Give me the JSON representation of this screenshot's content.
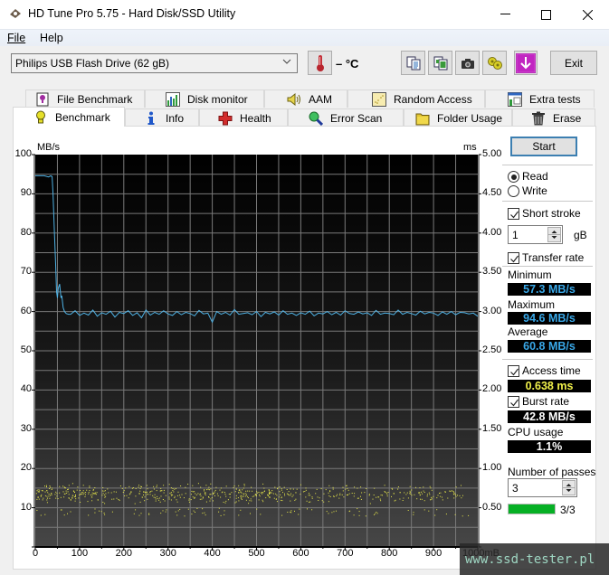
{
  "window": {
    "title": "HD Tune Pro 5.75 - Hard Disk/SSD Utility",
    "minimize_icon": "minimize-icon",
    "maximize_icon": "maximize-icon",
    "close_icon": "close-icon"
  },
  "menu": {
    "items": [
      {
        "label": "File"
      },
      {
        "label": "Help"
      }
    ]
  },
  "toolbar": {
    "drive": "Philips USB Flash Drive (62 gB)",
    "temperature": "– °C",
    "buttons": [
      "copy-text-icon",
      "copy-screenshot-icon",
      "camera-icon",
      "options-icon",
      "save-icon"
    ],
    "exit_label": "Exit"
  },
  "tabs": {
    "row1": [
      {
        "label": "File Benchmark",
        "icon": "file-benchmark-icon"
      },
      {
        "label": "Disk monitor",
        "icon": "disk-monitor-icon"
      },
      {
        "label": "AAM",
        "icon": "speaker-icon"
      },
      {
        "label": "Random Access",
        "icon": "random-access-icon"
      },
      {
        "label": "Extra tests",
        "icon": "extra-tests-icon"
      }
    ],
    "row2": [
      {
        "label": "Benchmark",
        "icon": "benchmark-icon",
        "active": true
      },
      {
        "label": "Info",
        "icon": "info-icon"
      },
      {
        "label": "Health",
        "icon": "health-icon"
      },
      {
        "label": "Error Scan",
        "icon": "magnifier-icon"
      },
      {
        "label": "Folder Usage",
        "icon": "folder-icon"
      },
      {
        "label": "Erase",
        "icon": "trash-icon"
      }
    ]
  },
  "controls": {
    "start_label": "Start",
    "read_label": "Read",
    "write_label": "Write",
    "mode": "Read",
    "short_stroke_label": "Short stroke",
    "short_stroke_checked": true,
    "short_stroke_value": "1",
    "short_stroke_unit": "gB",
    "transfer_rate_label": "Transfer rate",
    "transfer_rate_checked": true,
    "minimum_label": "Minimum",
    "minimum_value": "57.3 MB/s",
    "maximum_label": "Maximum",
    "maximum_value": "94.6 MB/s",
    "average_label": "Average",
    "average_value": "60.8 MB/s",
    "access_time_label": "Access time",
    "access_time_checked": true,
    "access_time_value": "0.638 ms",
    "burst_rate_label": "Burst rate",
    "burst_rate_checked": true,
    "burst_rate_value": "42.8 MB/s",
    "cpu_usage_label": "CPU usage",
    "cpu_usage_value": "1.1%",
    "passes_label": "Number of passes",
    "passes_value": "3",
    "progress_fraction": 1.0,
    "progress_text": "3/3"
  },
  "colors": {
    "transfer_line": "#4fb3e6",
    "access_dots": "#e8e84a",
    "min_max_avg_text": "#39a8e8",
    "access_text": "#f0f04a",
    "burst_text": "#ffffff",
    "progress": "#06b025"
  },
  "watermark": "www.ssd-tester.pl",
  "chart_data": {
    "type": "line",
    "title": "",
    "ylabel": "MB/s",
    "y2label": "ms",
    "xlabel": "mB",
    "xlim": [
      0,
      1000
    ],
    "ylim": [
      0,
      100
    ],
    "y2lim": [
      0,
      5
    ],
    "x_ticks": [
      "0",
      "100",
      "200",
      "300",
      "400",
      "500",
      "600",
      "700",
      "800",
      "900",
      "1000mB"
    ],
    "y_ticks": [
      "10",
      "20",
      "30",
      "40",
      "50",
      "60",
      "70",
      "80",
      "90",
      "100"
    ],
    "y2_ticks": [
      "0.50",
      "1.00",
      "1.50",
      "2.00",
      "2.50",
      "3.00",
      "3.50",
      "4.00",
      "4.50",
      "5.00"
    ],
    "grid": true,
    "series": [
      {
        "name": "Transfer rate",
        "axis": "left",
        "x": [
          0,
          10,
          20,
          30,
          35,
          38,
          40,
          43,
          46,
          48,
          50,
          52,
          55,
          58,
          60,
          63,
          66,
          70,
          75,
          80,
          90,
          100,
          110,
          120,
          130,
          140,
          150,
          160,
          170,
          180,
          190,
          200,
          210,
          220,
          230,
          240,
          250,
          260,
          270,
          280,
          290,
          300,
          310,
          320,
          330,
          340,
          350,
          360,
          370,
          380,
          390,
          400,
          410,
          420,
          430,
          440,
          450,
          460,
          470,
          480,
          490,
          500,
          510,
          520,
          530,
          540,
          550,
          560,
          570,
          580,
          590,
          600,
          610,
          620,
          630,
          640,
          650,
          660,
          670,
          680,
          690,
          700,
          710,
          720,
          730,
          740,
          750,
          760,
          770,
          780,
          790,
          800,
          810,
          820,
          830,
          840,
          850,
          860,
          870,
          880,
          890,
          900,
          910,
          920,
          930,
          940,
          950,
          960,
          970,
          980,
          990,
          1000
        ],
        "values": [
          94.6,
          94.6,
          94.6,
          94.3,
          94.6,
          94.4,
          90,
          81,
          72,
          65,
          63.5,
          66,
          67,
          63.5,
          64,
          61,
          60,
          59.5,
          59.3,
          59.3,
          60.2,
          59.0,
          59.6,
          59.1,
          60.4,
          58.8,
          59.7,
          59.3,
          60.1,
          58.6,
          59.8,
          59.5,
          60.2,
          59.0,
          59.7,
          58.4,
          60.4,
          59.1,
          59.8,
          59.3,
          60.2,
          59.4,
          59.0,
          60.0,
          59.2,
          59.8,
          59.5,
          58.9,
          60.3,
          59.4,
          59.6,
          57.3,
          60.0,
          59.3,
          59.8,
          59.1,
          60.5,
          59.3,
          59.5,
          59.7,
          59.2,
          60.0,
          58.7,
          59.8,
          59.4,
          59.9,
          59.1,
          60.2,
          59.3,
          59.6,
          59.0,
          59.7,
          59.3,
          60.1,
          58.9,
          59.6,
          59.4,
          60.0,
          59.2,
          59.8,
          59.1,
          60.2,
          59.5,
          59.3,
          59.9,
          59.4,
          59.7,
          59.0,
          60.3,
          59.3,
          59.6,
          59.5,
          59.2,
          60.4,
          59.3,
          59.8,
          59.5,
          59.1,
          60.1,
          59.4,
          59.8,
          59.6,
          59.0,
          59.9,
          59.3,
          60.0,
          59.2,
          59.8,
          59.7,
          59.4,
          59.6,
          58.8
        ]
      },
      {
        "name": "Access time",
        "axis": "right",
        "type": "scatter",
        "x_range": [
          0,
          980
        ],
        "y_center_ms": 0.64,
        "y_spread_ms": [
          0.38,
          0.85
        ]
      }
    ]
  }
}
